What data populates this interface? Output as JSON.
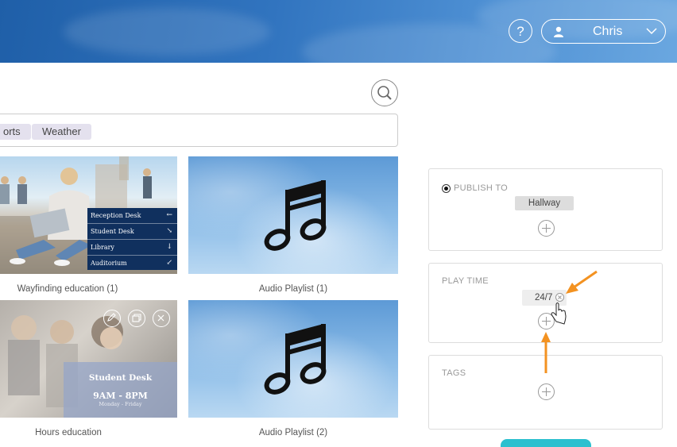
{
  "header": {
    "help_glyph": "?",
    "user_name": "Chris"
  },
  "tags": {
    "chips": [
      "orts",
      "Weather"
    ]
  },
  "cards": [
    {
      "caption": "Wayfinding education (1)",
      "menu": [
        {
          "label": "Reception Desk",
          "arrow": "←"
        },
        {
          "label": "Student Desk",
          "arrow": "↘"
        },
        {
          "label": "Library",
          "arrow": "↓"
        },
        {
          "label": "Auditorium",
          "arrow": "↙"
        }
      ]
    },
    {
      "caption": "Audio Playlist (1)",
      "icon": "music-note-icon"
    },
    {
      "caption": "Hours education",
      "overlay_title": "Student Desk",
      "overlay_hours": "9AM - 8PM",
      "overlay_days": "Monday - Friday"
    },
    {
      "caption": "Audio Playlist (2)",
      "icon": "music-note-icon"
    }
  ],
  "panels": {
    "publish_to": {
      "label": "PUBLISH TO",
      "value": "Hallway"
    },
    "play_time": {
      "label": "PLAY TIME",
      "value": "24/7"
    },
    "tags": {
      "label": "TAGS"
    }
  },
  "colors": {
    "annotation_arrow": "#f39221",
    "accent": "#2cc0cf"
  }
}
